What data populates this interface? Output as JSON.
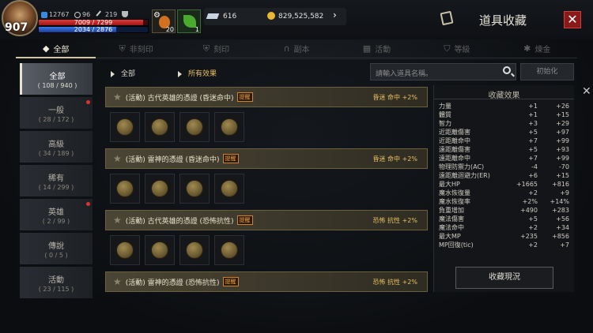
{
  "player": {
    "level": "907",
    "stat1": "12767",
    "stat2": "96",
    "stat3": "219",
    "hp": "7009 / 7299",
    "mp": "2034 / 2876",
    "hp_fill": 0.96,
    "mp_fill": 0.71
  },
  "buffs": [
    {
      "icon": "potion-icon",
      "count": "20"
    },
    {
      "icon": "leaf-icon",
      "count": "1"
    }
  ],
  "currency": {
    "gems": "616",
    "gold": "829,525,582"
  },
  "header": {
    "title": "道具收藏"
  },
  "tabs": [
    {
      "icon": "all-icon",
      "label": "全部"
    },
    {
      "icon": "non-sealed-icon",
      "label": "非刻印"
    },
    {
      "icon": "sealed-icon",
      "label": "刻印"
    },
    {
      "icon": "dungeon-icon",
      "label": "副本"
    },
    {
      "icon": "event-icon",
      "label": "活動"
    },
    {
      "icon": "grade-icon",
      "label": "等級"
    },
    {
      "icon": "alchemy-icon",
      "label": "煉金"
    }
  ],
  "categories": [
    {
      "label": "全部",
      "count": "( 108 / 940 )",
      "active": true,
      "dot": false
    },
    {
      "label": "一般",
      "count": "( 28 / 172 )",
      "dot": true
    },
    {
      "label": "高級",
      "count": "( 34 / 189 )",
      "dot": false
    },
    {
      "label": "稀有",
      "count": "( 14 / 299 )",
      "dot": false
    },
    {
      "label": "英雄",
      "count": "( 2 / 99 )",
      "dot": true
    },
    {
      "label": "傳說",
      "count": "( 0 / 5 )",
      "dot": false
    },
    {
      "label": "活動",
      "count": "( 23 / 115 )",
      "dot": false
    }
  ],
  "filter": {
    "all": "全部",
    "effect": "所有效果",
    "search_placeholder": "請輸入道具名稱。",
    "init": "初始化"
  },
  "groups": [
    {
      "name": "(活動) 古代英雄的憑證 (昏迷命中)",
      "hint": "提醒",
      "effect": "昏迷 命中 +2%",
      "slots": 4
    },
    {
      "name": "(活動) 雷神的憑證 (昏迷命中)",
      "hint": "提醒",
      "effect": "昏迷 命中 +2%",
      "slots": 4
    },
    {
      "name": "(活動) 古代英雄的憑證 (恐怖抗性)",
      "hint": "提醒",
      "effect": "恐怖 抗性 +2%",
      "slots": 4
    },
    {
      "name": "(活動) 雷神的憑證 (恐怖抗性)",
      "hint": "提醒",
      "effect": "恐怖 抗性 +2%",
      "slots": 4
    }
  ],
  "effects": {
    "title": "收藏效果",
    "rows": [
      [
        "力量",
        "+1",
        "+26"
      ],
      [
        "體質",
        "+1",
        "+15"
      ],
      [
        "智力",
        "+3",
        "+29"
      ],
      [
        "近距離傷害",
        "+5",
        "+97"
      ],
      [
        "近距離命中",
        "+7",
        "+99"
      ],
      [
        "遠距離傷害",
        "+5",
        "+93"
      ],
      [
        "遠距離命中",
        "+7",
        "+99"
      ],
      [
        "物理防禦力(AC)",
        "-4",
        "-70"
      ],
      [
        "遠距離迴避力(ER)",
        "+6",
        "+15"
      ],
      [
        "最大HP",
        "+1665",
        "+816"
      ],
      [
        "魔水恢復量",
        "+2",
        "+9"
      ],
      [
        "魔水恢復率",
        "+2%",
        "+14%"
      ],
      [
        "負重增加",
        "+490",
        "+283"
      ],
      [
        "魔法傷害",
        "+5",
        "+56"
      ],
      [
        "魔法命中",
        "+2",
        "+34"
      ],
      [
        "最大MP",
        "+235",
        "+856"
      ],
      [
        "MP回復(tic)",
        "+2",
        "+7"
      ]
    ],
    "status_button": "收藏現況"
  }
}
